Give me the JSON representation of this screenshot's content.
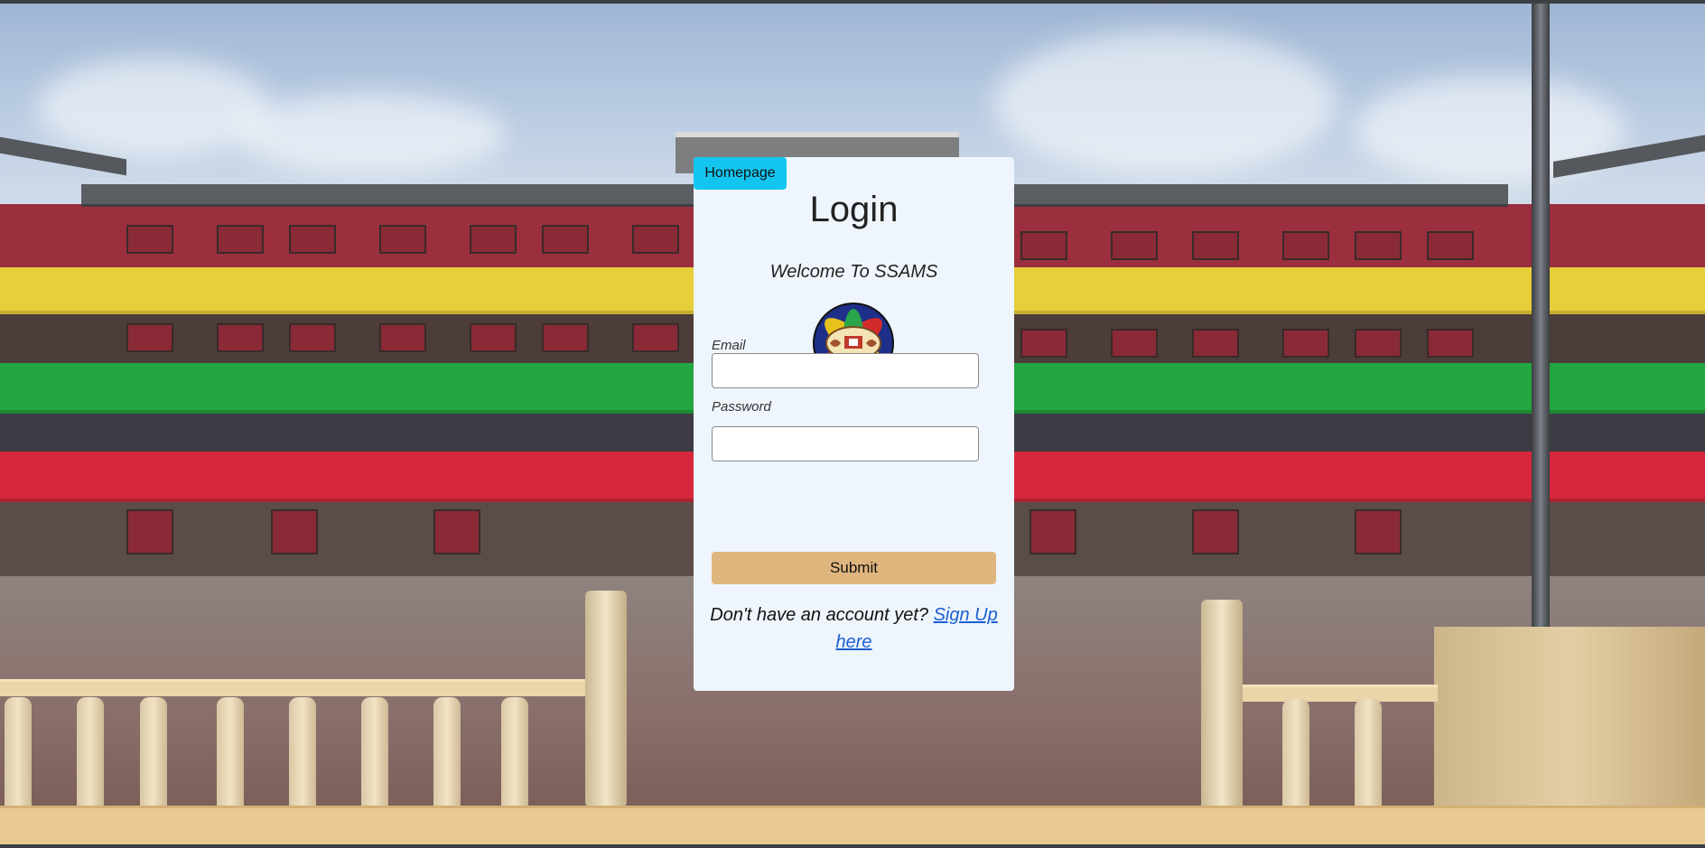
{
  "nav": {
    "homepage_label": "Homepage"
  },
  "login": {
    "title": "Login",
    "welcome": "Welcome To SSAMS",
    "email_label": "Email",
    "email_value": "",
    "password_label": "Password",
    "password_value": "",
    "submit_label": "Submit",
    "signup_prompt": "Don't have an account yet?",
    "signup_link": "Sign Up here"
  },
  "icons": {
    "logo": "school-crest-logo"
  },
  "colors": {
    "homepage_button": "#12c5ef",
    "submit_button": "#dfb57e",
    "card_background": "#eef5fc",
    "link": "#1a5fd0"
  }
}
